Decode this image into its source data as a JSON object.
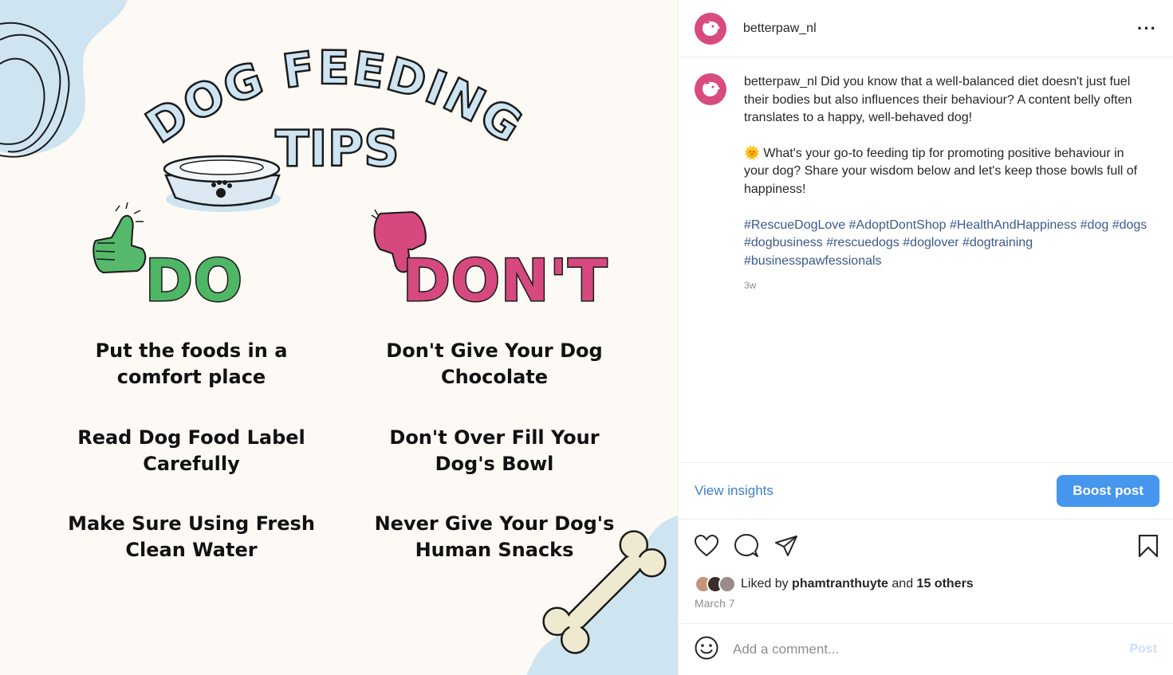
{
  "image": {
    "title_line1": "DOG FEEDING",
    "title_line2": "TIPS",
    "do_heading": "DO",
    "dont_heading": "DON'T",
    "do_tips": [
      "Put the foods in a comfort place",
      "Read Dog Food Label Carefully",
      "Make Sure Using Fresh Clean Water"
    ],
    "dont_tips": [
      "Don't Give Your Dog Chocolate",
      "Don't Over Fill Your Dog's Bowl",
      "Never Give Your Dog's Human Snacks"
    ],
    "colors": {
      "do": "#4fb665",
      "dont": "#d6497e",
      "title": "#cde4f2",
      "background": "#fdf9f5"
    }
  },
  "header": {
    "username": "betterpaw_nl",
    "more_icon": "more-horizontal-icon"
  },
  "caption": {
    "username": "betterpaw_nl",
    "paragraph1": "Did you know that a well-balanced diet doesn't just fuel their bodies but also influences their behaviour? A content belly often translates to a happy, well-behaved dog!",
    "paragraph2": "🌞 What's your go-to feeding tip for promoting positive behaviour in your dog? Share your wisdom below and let's keep those bowls full of happiness!",
    "hashtags": [
      "#RescueDogLove",
      "#AdoptDontShop",
      "#HealthAndHappiness",
      "#dog",
      "#dogs",
      "#dogbusiness",
      "#rescuedogs",
      "#doglover",
      "#dogtraining",
      "#businesspawfessionals"
    ],
    "time_ago": "3w"
  },
  "insights": {
    "view_label": "View insights",
    "boost_label": "Boost post"
  },
  "actions": {
    "icons": [
      "heart-icon",
      "comment-icon",
      "share-icon",
      "bookmark-icon"
    ]
  },
  "likes": {
    "prefix": "Liked by ",
    "user": "phamtranthuyte",
    "middle": " and ",
    "others": "15 others",
    "date": "March 7"
  },
  "comment": {
    "placeholder": "Add a comment...",
    "post_label": "Post"
  },
  "accent": "#4596ec"
}
